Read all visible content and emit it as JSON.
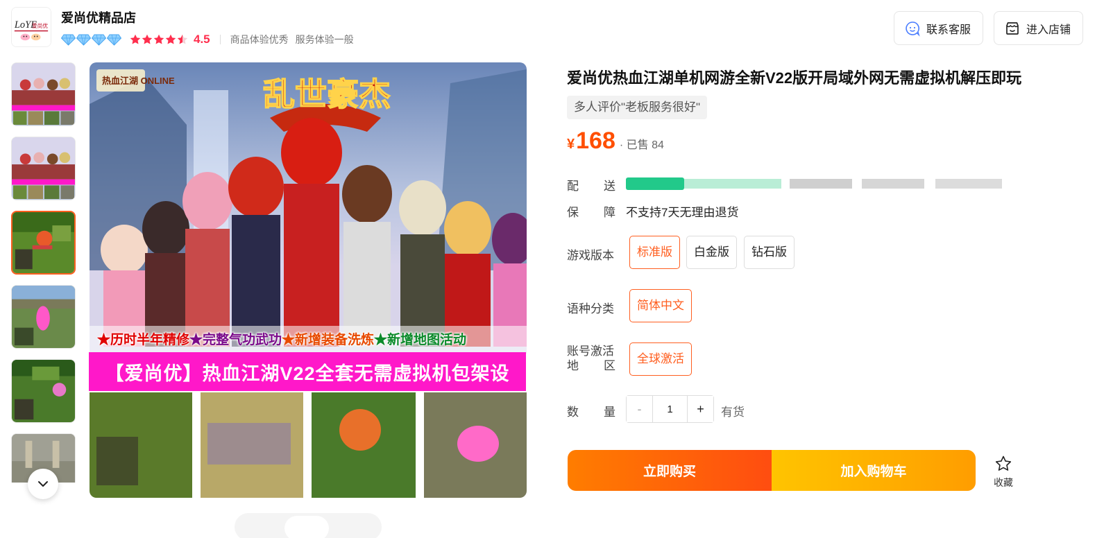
{
  "shop": {
    "name": "爱尚优精品店",
    "logo_text": "爱尚优",
    "rating": "4.5",
    "tags": [
      "商品体验优秀",
      "服务体验一般"
    ],
    "diamond_count": 4,
    "star_count": 4.5
  },
  "header": {
    "service_label": "联系客服",
    "store_label": "进入店铺"
  },
  "gallery": {
    "thumb_count": 6,
    "active_index": 2,
    "banner_strip": "【爱尚优】热血江湖V22全套无需虚拟机包架设",
    "slogans": [
      "★历时半年精修",
      "★完整气功武功",
      "★新增装备洗炼",
      "★新增地图活动"
    ],
    "game_logo": "热血江湖 ONLINE",
    "game_title": "乱世豪杰"
  },
  "product": {
    "title": "爱尚优热血江湖单机网游全新V22版开局域外网无需虚拟机解压即玩",
    "review_tag": "多人评价\"老板服务很好\"",
    "currency": "¥",
    "price": "168",
    "sold": "· 已售 84",
    "shipping_label": "配送",
    "guarantee_label": "保障",
    "guarantee_value": "不支持7天无理由退货",
    "version_label": "游戏版本",
    "versions": [
      "标准版",
      "白金版",
      "钻石版"
    ],
    "selected_version": "标准版",
    "language_label": "语种分类",
    "language": "简体中文",
    "region_label_1": "账号激活",
    "region_label_2": "地区",
    "region": "全球激活",
    "quantity_label": "数量",
    "quantity_minus": "-",
    "quantity_plus": "+",
    "quantity": "1",
    "stock": "有货"
  },
  "actions": {
    "buy_now": "立即购买",
    "add_cart": "加入购物车",
    "favorite": "收藏"
  },
  "colors": {
    "accent": "#ff5e1f",
    "price": "#ff4f00",
    "rating": "#ff2e4d",
    "buy_start": "#ff7d00",
    "cart_start": "#ffc400",
    "strip": "#ff18c9"
  }
}
